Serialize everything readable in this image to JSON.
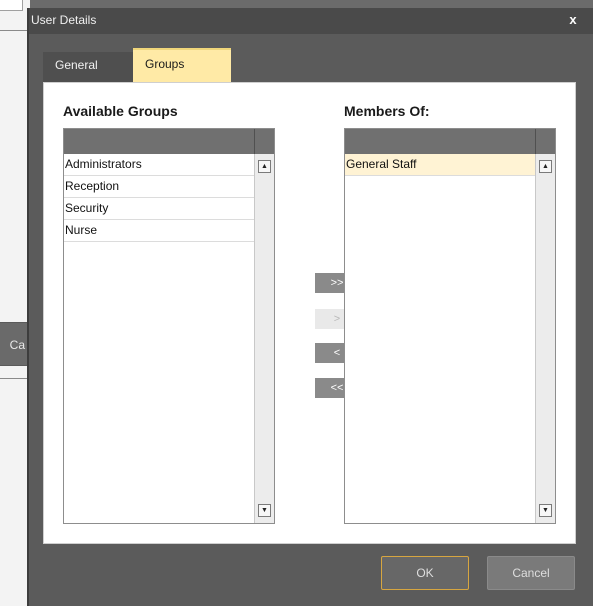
{
  "background_window": {
    "button_fragment": "Ca"
  },
  "dialog": {
    "title": "User Details",
    "close_glyph": "x"
  },
  "tabs": [
    {
      "label": "General",
      "selected": false
    },
    {
      "label": "Groups",
      "selected": true
    }
  ],
  "available_groups": {
    "label": "Available Groups",
    "items": [
      "Administrators",
      "Reception",
      "Security",
      "Nurse"
    ]
  },
  "members_of": {
    "label": "Members Of:",
    "items": [
      "General Staff"
    ],
    "selected_index": 0
  },
  "move_buttons": {
    "add_all": ">>",
    "add": ">",
    "remove": "<",
    "remove_all": "<<"
  },
  "footer": {
    "ok_label": "OK",
    "cancel_label": "Cancel"
  },
  "colors": {
    "accent_tab": "#ffeaa6",
    "selected_row": "#fff3d4",
    "ok_border": "#d7a640"
  }
}
